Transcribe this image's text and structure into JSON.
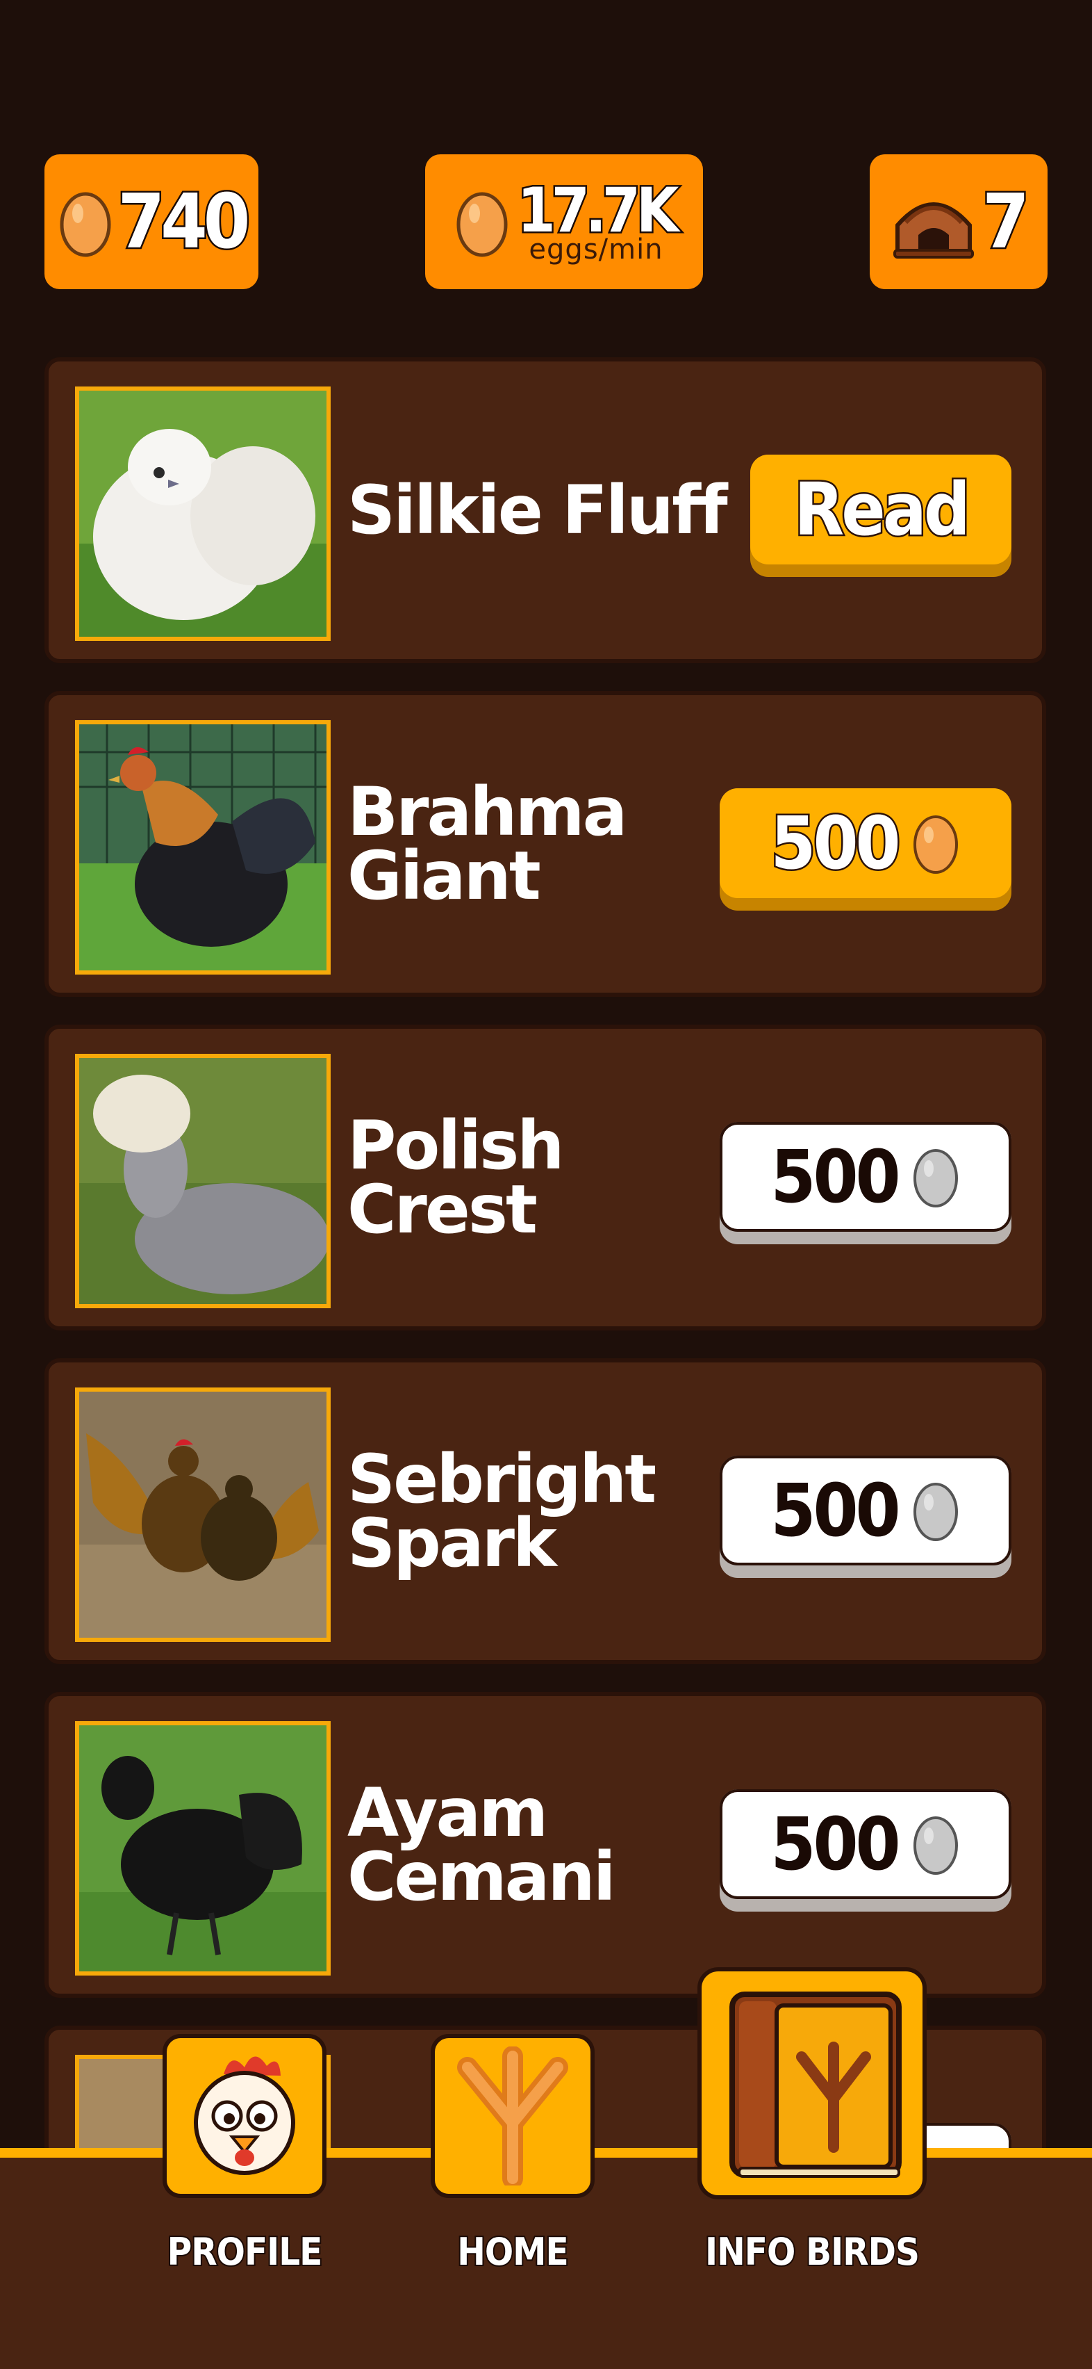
{
  "stats": {
    "eggs": "740",
    "rate_value": "17.7K",
    "rate_unit": "eggs/min",
    "coops": "7"
  },
  "birds": [
    {
      "name": "Silkie Fluff",
      "action": "Read",
      "state": "owned"
    },
    {
      "name": "Brahma Giant",
      "action": "500",
      "state": "affordable"
    },
    {
      "name": "Polish Crest",
      "action": "500",
      "state": "locked"
    },
    {
      "name": "Sebright Spark",
      "action": "500",
      "state": "locked"
    },
    {
      "name": "Ayam Cemani",
      "action": "500",
      "state": "locked"
    }
  ],
  "nav": {
    "profile": "PROFILE",
    "home": "HOME",
    "info_birds": "INFO BIRDS"
  },
  "colors": {
    "background": "#1e0f0a",
    "card": "#4a2412",
    "accent_orange": "#ff8c00",
    "accent_gold": "#ffb000"
  }
}
